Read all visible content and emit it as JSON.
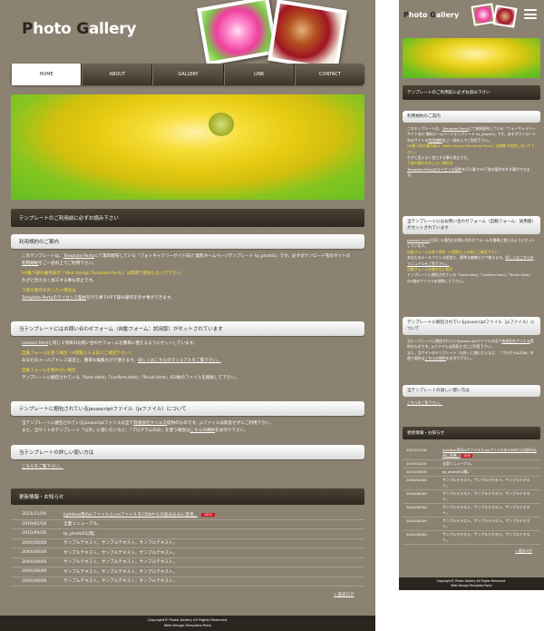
{
  "logo": {
    "cap1": "P",
    "rest1": "hoto ",
    "cap2": "G",
    "rest2": "allery"
  },
  "nav": [
    "HOME",
    "ABOUT",
    "GALLERY",
    "LINK",
    "CONTACT"
  ],
  "read_first_heading": "テンプレートのご利用前に必ずお読み下さい",
  "terms": {
    "title": "利用規約のご案内",
    "p1a": "このテンプレートは、",
    "p1_link1": "Template Party",
    "p1b": "にて無料配布している『フォトギャラリーサイト向け 無料ホームページテンプレート tp_photo5』です。必ずダウンロード先のサイトの",
    "p1_link2": "利用規約",
    "p1c": "をご一読の上でご利用下さい。",
    "y1": "HP最下部の著作表示『Web Design:Template-Party』は無断で削除しないで下さい。",
    "p2": "わざと見えなく加工する事も禁止です。",
    "y2": "下部の著作を外したい場合は",
    "p3_link": "Template-Partyのライセンス契約",
    "p3b": "を行う事でHP下部の著作を外す事ができます。"
  },
  "form": {
    "title": "当テンプレートにはお問い合わせフォーム（自動フォーム：試用版）がセットされています",
    "p1_link": "contact.html",
    "p1b": "と同じ３項目のお問い合わせフォームを簡単に使えるようにセットしています。",
    "y1": "自動フォームを使う場合（※閲覧に入る前にご確認下さい）",
    "p2a": "あなたのメールアドレス設定と、簡単な編集だけで使えます。",
    "p2_link": "詳しくはこちらのマニュアルをご覧下さい。",
    "y2": "自動フォームを使わない場合",
    "p3": "テンプレートに梱包されている「form.html」「confirm.html」「finish.html」の3枚のファイルを削除して下さい。"
  },
  "js": {
    "title": "テンプレートに梱包されているjavascriptファイル（jsファイル）について",
    "p1a": "当テンプレートに梱包されているjavascriptファイルは全て",
    "p1_link": "有限会社クリエス",
    "p1b": "提供のものです。jsファイルは改変せずにご利用下さい。",
    "p2a": "また、当サイトのテンプレート「以外」に使いたいなど、『プログラムのみ』を使う場合は",
    "p2_link": "こちらの規約",
    "p2b": "をお守り下さい。"
  },
  "howto": {
    "title": "当テンプレートの詳しい使い方は",
    "link": "こちらをご覧下さい。"
  },
  "news": {
    "heading": "更新情報・お知らせ",
    "items": [
      {
        "date": "2021/11/16",
        "text": "lightbox用のjsファイルとcssファイルをCDNからの読み込みに変更。",
        "new": "NEW"
      },
      {
        "date": "2019/02/18",
        "text": "全面リニューアル。"
      },
      {
        "date": "2015/09/28",
        "text": "tp_photo5公開。"
      },
      {
        "date": "20XX/00/00",
        "text": "サンプルテキスト。サンプルテキスト。サンプルテキスト。"
      },
      {
        "date": "20XX/00/00",
        "text": "サンプルテキスト。サンプルテキスト。サンプルテキスト。"
      },
      {
        "date": "20XX/00/00",
        "text": "サンプルテキスト。サンプルテキスト。サンプルテキスト。"
      },
      {
        "date": "20XX/00/00",
        "text": "サンプルテキスト。サンプルテキスト。サンプルテキスト。"
      },
      {
        "date": "20XX/00/00",
        "text": "サンプルテキスト。サンプルテキスト。サンプルテキスト。"
      }
    ],
    "more": "» 過去ログ"
  },
  "footer": {
    "copyright": "Copyright© Photo Gallery All Rights Reserved.",
    "credit": "Web Design:Template-Party"
  },
  "colors": {
    "body_bg": "#8c8272",
    "nav_dark": "#3c3429",
    "accent_yellow": "#f4e23c",
    "new_badge": "#d40f1a"
  }
}
